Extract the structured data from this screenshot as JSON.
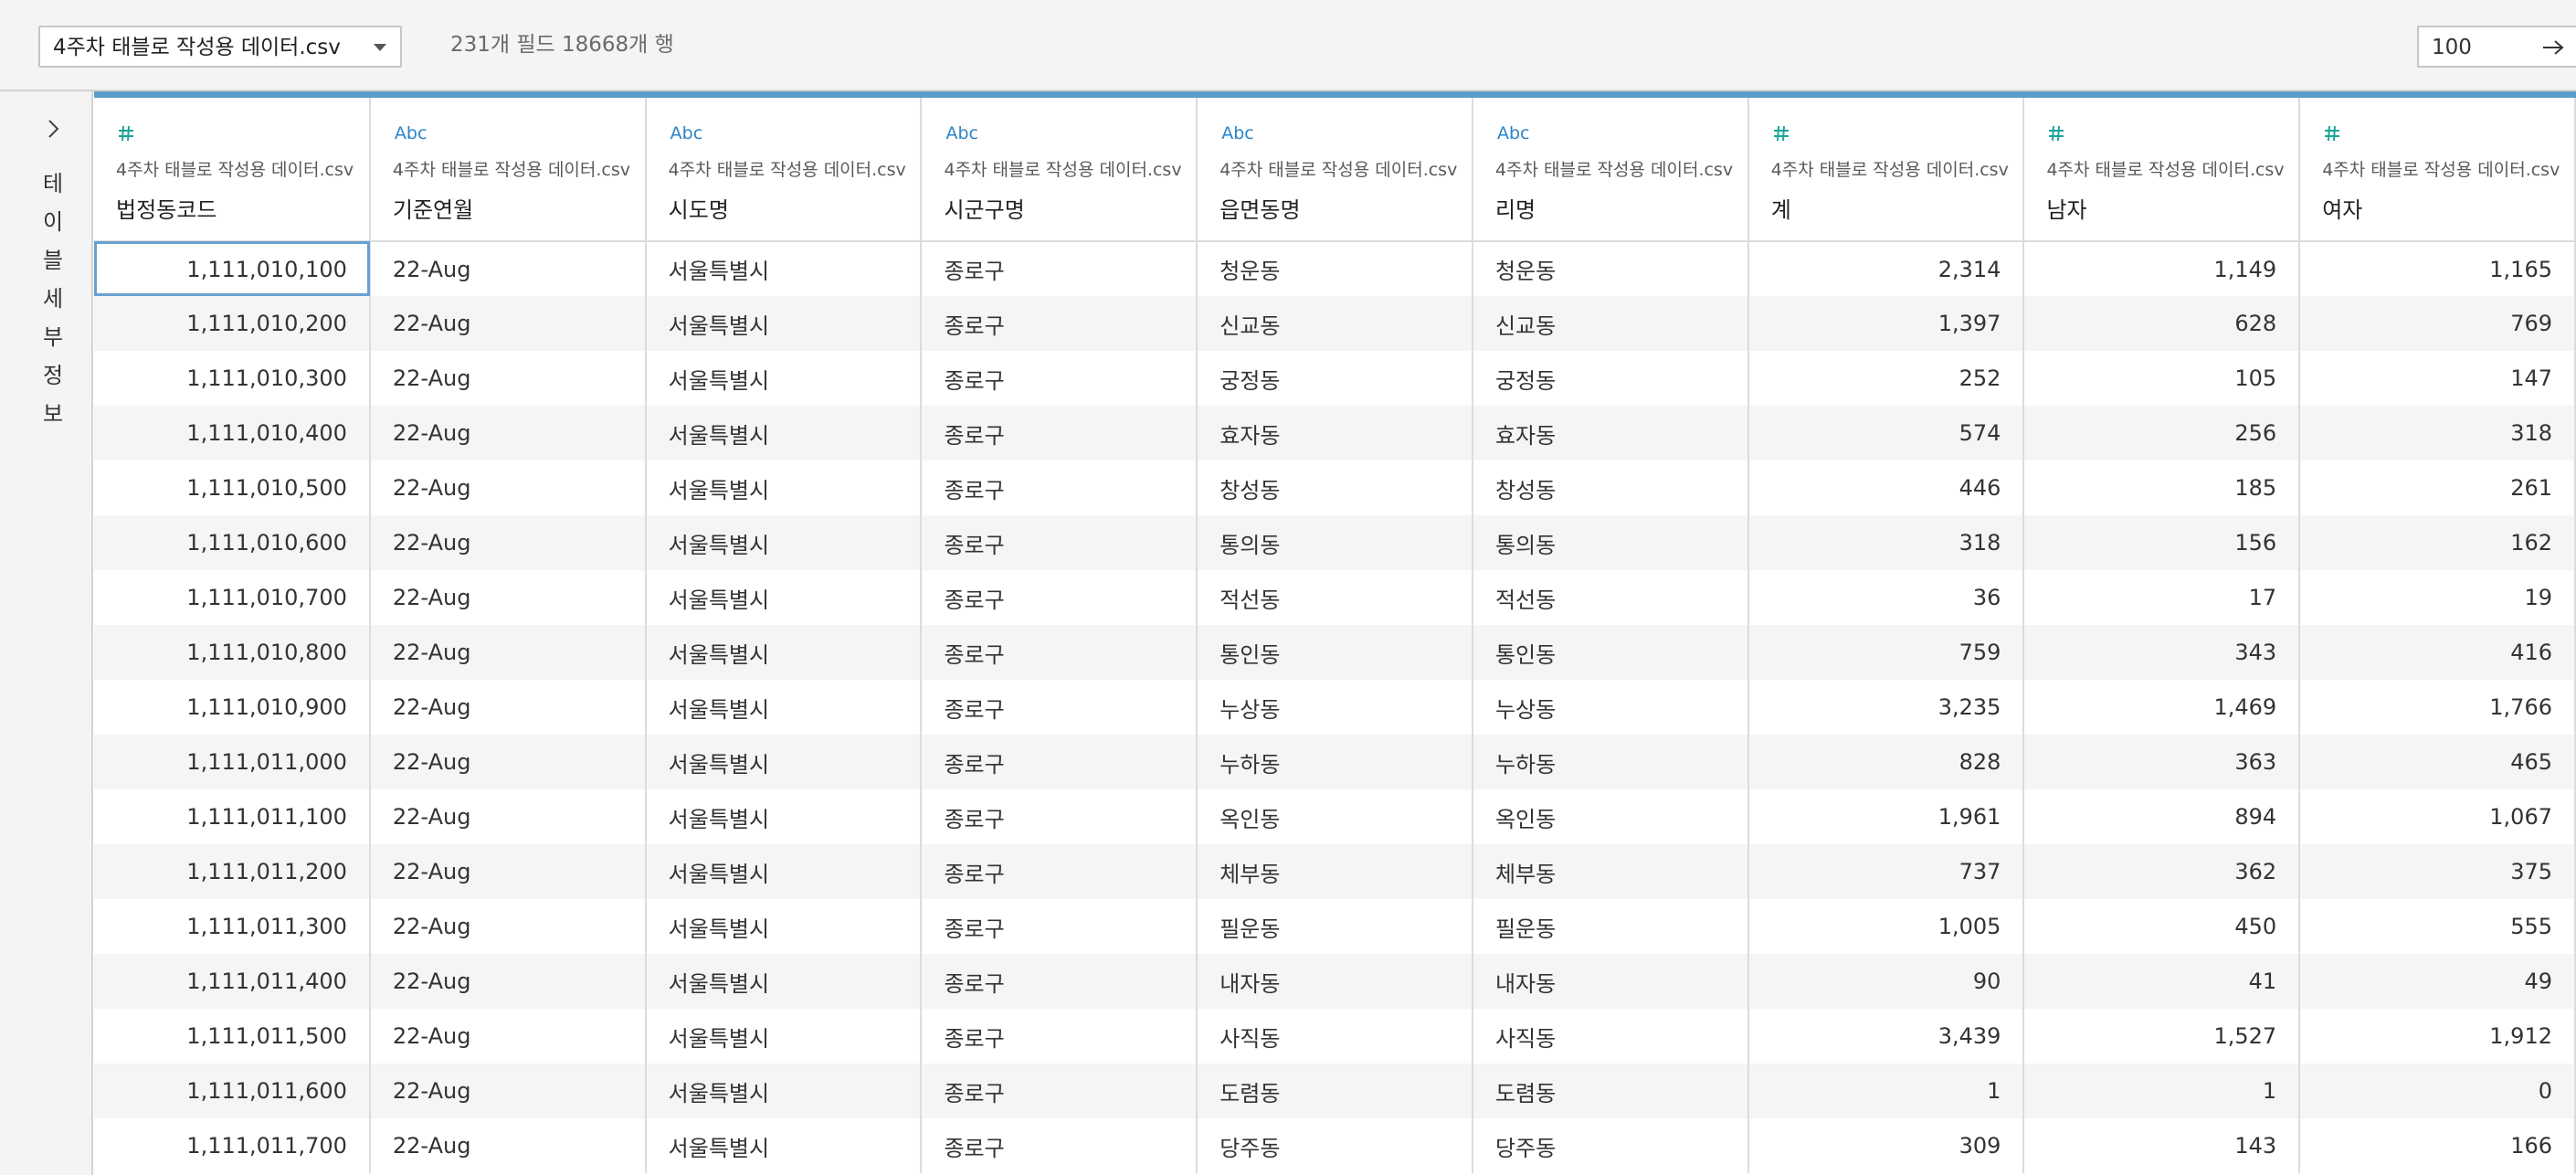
{
  "toolbar": {
    "source_label": "4주차 태블로 작성용 데이터.csv",
    "field_count": "231개 필드 18668개 행",
    "rows_value": "100"
  },
  "sidebar": {
    "title": "테이블 세부 정보"
  },
  "columns": [
    {
      "type": "number",
      "source": "4주차 태블로 작성용 데이터.csv",
      "name": "법정동코드"
    },
    {
      "type": "string",
      "type_label": "Abc",
      "source": "4주차 태블로 작성용 데이터.csv",
      "name": "기준연월"
    },
    {
      "type": "string",
      "type_label": "Abc",
      "source": "4주차 태블로 작성용 데이터.csv",
      "name": "시도명"
    },
    {
      "type": "string",
      "type_label": "Abc",
      "source": "4주차 태블로 작성용 데이터.csv",
      "name": "시군구명"
    },
    {
      "type": "string",
      "type_label": "Abc",
      "source": "4주차 태블로 작성용 데이터.csv",
      "name": "읍면동명"
    },
    {
      "type": "string",
      "type_label": "Abc",
      "source": "4주차 태블로 작성용 데이터.csv",
      "name": "리명"
    },
    {
      "type": "number",
      "source": "4주차 태블로 작성용 데이터.csv",
      "name": "계"
    },
    {
      "type": "number",
      "source": "4주차 태블로 작성용 데이터.csv",
      "name": "남자"
    },
    {
      "type": "number",
      "source": "4주차 태블로 작성용 데이터.csv",
      "name": "여자"
    }
  ],
  "rows": [
    [
      "1,111,010,100",
      "22-Aug",
      "서울특별시",
      "종로구",
      "청운동",
      "청운동",
      "2,314",
      "1,149",
      "1,165"
    ],
    [
      "1,111,010,200",
      "22-Aug",
      "서울특별시",
      "종로구",
      "신교동",
      "신교동",
      "1,397",
      "628",
      "769"
    ],
    [
      "1,111,010,300",
      "22-Aug",
      "서울특별시",
      "종로구",
      "궁정동",
      "궁정동",
      "252",
      "105",
      "147"
    ],
    [
      "1,111,010,400",
      "22-Aug",
      "서울특별시",
      "종로구",
      "효자동",
      "효자동",
      "574",
      "256",
      "318"
    ],
    [
      "1,111,010,500",
      "22-Aug",
      "서울특별시",
      "종로구",
      "창성동",
      "창성동",
      "446",
      "185",
      "261"
    ],
    [
      "1,111,010,600",
      "22-Aug",
      "서울특별시",
      "종로구",
      "통의동",
      "통의동",
      "318",
      "156",
      "162"
    ],
    [
      "1,111,010,700",
      "22-Aug",
      "서울특별시",
      "종로구",
      "적선동",
      "적선동",
      "36",
      "17",
      "19"
    ],
    [
      "1,111,010,800",
      "22-Aug",
      "서울특별시",
      "종로구",
      "통인동",
      "통인동",
      "759",
      "343",
      "416"
    ],
    [
      "1,111,010,900",
      "22-Aug",
      "서울특별시",
      "종로구",
      "누상동",
      "누상동",
      "3,235",
      "1,469",
      "1,766"
    ],
    [
      "1,111,011,000",
      "22-Aug",
      "서울특별시",
      "종로구",
      "누하동",
      "누하동",
      "828",
      "363",
      "465"
    ],
    [
      "1,111,011,100",
      "22-Aug",
      "서울특별시",
      "종로구",
      "옥인동",
      "옥인동",
      "1,961",
      "894",
      "1,067"
    ],
    [
      "1,111,011,200",
      "22-Aug",
      "서울특별시",
      "종로구",
      "체부동",
      "체부동",
      "737",
      "362",
      "375"
    ],
    [
      "1,111,011,300",
      "22-Aug",
      "서울특별시",
      "종로구",
      "필운동",
      "필운동",
      "1,005",
      "450",
      "555"
    ],
    [
      "1,111,011,400",
      "22-Aug",
      "서울특별시",
      "종로구",
      "내자동",
      "내자동",
      "90",
      "41",
      "49"
    ],
    [
      "1,111,011,500",
      "22-Aug",
      "서울특별시",
      "종로구",
      "사직동",
      "사직동",
      "3,439",
      "1,527",
      "1,912"
    ],
    [
      "1,111,011,600",
      "22-Aug",
      "서울특별시",
      "종로구",
      "도렴동",
      "도렴동",
      "1",
      "1",
      "0"
    ],
    [
      "1,111,011,700",
      "22-Aug",
      "서울특별시",
      "종로구",
      "당주동",
      "당주동",
      "309",
      "143",
      "166"
    ]
  ],
  "colors": {
    "accent_line": "#5b9bc9",
    "number_icon": "#1aa597",
    "string_icon": "#2b84c8",
    "selected_cell": "#6aa0d0"
  }
}
